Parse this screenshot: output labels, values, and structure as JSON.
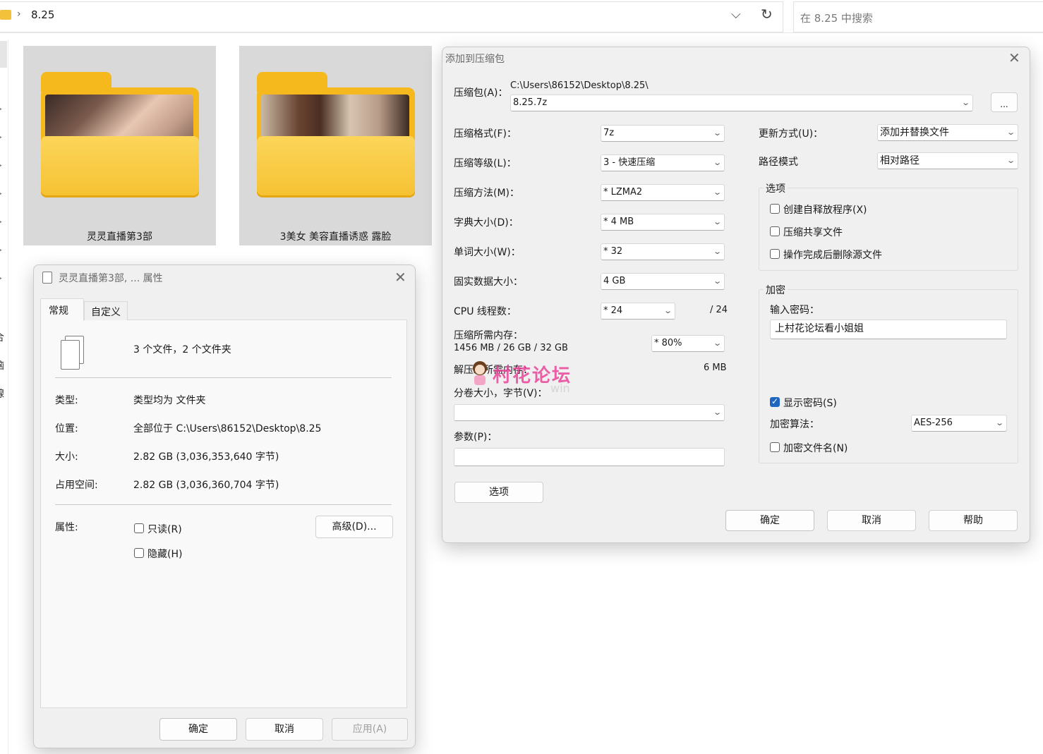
{
  "explorer": {
    "address": "8.25",
    "search_placeholder": "在 8.25 中搜索",
    "nav_labels": [
      "合",
      "脑",
      "腺"
    ],
    "folders": [
      {
        "name": "灵灵直播第3部"
      },
      {
        "name": "3美女 美容直播诱惑 露脸"
      }
    ]
  },
  "archive_dialog": {
    "title": "添加到压缩包",
    "archive_label": "压缩包(A)：",
    "archive_path": "C:\\Users\\86152\\Desktop\\8.25\\",
    "archive_name": "8.25.7z",
    "browse_label": "...",
    "format_label": "压缩格式(F)：",
    "format_value": "7z",
    "level_label": "压缩等级(L)：",
    "level_value": "3 - 快速压缩",
    "method_label": "压缩方法(M)：",
    "method_value": "*  LZMA2",
    "dict_label": "字典大小(D)：",
    "dict_value": "*  4 MB",
    "word_label": "单词大小(W)：",
    "word_value": "*  32",
    "solid_label": "固实数据大小：",
    "solid_value": "4 GB",
    "cpu_label": "CPU 线程数：",
    "cpu_value": "*  24",
    "cpu_total": "/ 24",
    "mem_label": "压缩所需内存：",
    "mem_detail": "1456 MB / 26 GB / 32 GB",
    "mem_value": "* 80%",
    "decomp_label": "解压缩所需内存：",
    "decomp_value": "6 MB",
    "split_label": "分卷大小，字节(V)：",
    "split_value": "",
    "params_label": "参数(P)：",
    "params_value": "",
    "options_button": "选项",
    "update_label": "更新方式(U)：",
    "update_value": "添加并替换文件",
    "pathmode_label": "路径模式",
    "pathmode_value": "相对路径",
    "options_group": "选项",
    "opt_sfx": "创建自释放程序(X)",
    "opt_shared": "压缩共享文件",
    "opt_delete": "操作完成后删除源文件",
    "encrypt_group": "加密",
    "password_label": "输入密码：",
    "password_value": "上村花论坛看小姐姐",
    "show_password": "显示密码(S)",
    "enc_method_label": "加密算法：",
    "enc_method_value": "AES-256",
    "encrypt_names": "加密文件名(N)",
    "ok": "确定",
    "cancel": "取消",
    "help": "帮助"
  },
  "watermark": {
    "text": "村花论坛",
    "sub": "win"
  },
  "props_dialog": {
    "title": "灵灵直播第3部, ... 属性",
    "tab_general": "常规",
    "tab_custom": "自定义",
    "summary": "3 个文件，2 个文件夹",
    "type_label": "类型:",
    "type_value": "类型均为 文件夹",
    "location_label": "位置:",
    "location_value": "全部位于 C:\\Users\\86152\\Desktop\\8.25",
    "size_label": "大小:",
    "size_value": "2.82 GB (3,036,353,640 字节)",
    "disk_label": "占用空间:",
    "disk_value": "2.82 GB (3,036,360,704 字节)",
    "attr_label": "属性:",
    "readonly": "只读(R)",
    "hidden": "隐藏(H)",
    "advanced": "高级(D)...",
    "ok": "确定",
    "cancel": "取消",
    "apply": "应用(A)"
  },
  "colors": {
    "folder_yellow": "#f6c233",
    "checkbox_blue": "#1f66c1",
    "watermark_pink": "#e8459a"
  }
}
